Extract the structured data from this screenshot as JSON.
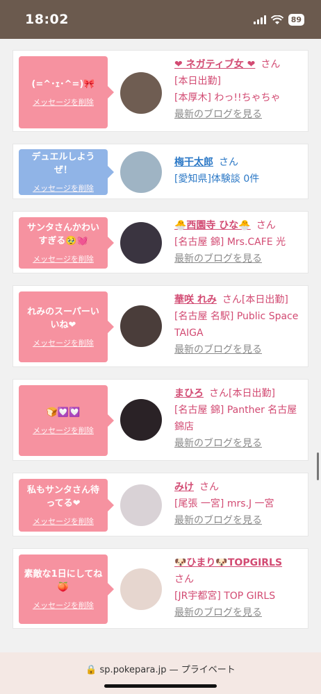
{
  "status": {
    "time": "18:02",
    "battery": "89"
  },
  "delete_label": "メッセージを削除",
  "san_label": "さん",
  "blog_label": "最新のブログを見る",
  "cards": [
    {
      "message": "(=^･ｪ･^=)🎀",
      "name": "❤︎ ネガティブ女 ❤︎",
      "tag": "",
      "lines": [
        "[本日出勤]",
        "[本厚木] わっ!!ちゃちゃ"
      ],
      "blog": true,
      "theme": "pink",
      "avatar_color": "#6f5d52"
    },
    {
      "message": "デュエルしようぜ！",
      "name": "梅干太郎",
      "tag": "",
      "lines": [
        "[愛知県]体験談 0件"
      ],
      "blog": false,
      "theme": "blue",
      "avatar_color": "#9fb4c4"
    },
    {
      "message": "サンタさんかわいすぎる🥹💓",
      "name": "🐣西園寺 ひな🐣",
      "tag": "",
      "lines": [
        "[名古屋 錦] Mrs.CAFE 光"
      ],
      "blog": true,
      "theme": "pink",
      "avatar_color": "#3a3440"
    },
    {
      "message": "れみのスーパーいいね❤︎",
      "name": "華咲 れみ",
      "tag": "[本日出勤]",
      "lines": [
        "[名古屋 名駅] Public Space TAIGA"
      ],
      "blog": true,
      "theme": "pink",
      "avatar_color": "#4a3d3a"
    },
    {
      "message": "🍞💟💟",
      "name": "まひろ",
      "tag": "[本日出勤]",
      "lines": [
        "[名古屋 錦] Panther 名古屋錦店"
      ],
      "blog": true,
      "theme": "pink",
      "avatar_color": "#2a2226"
    },
    {
      "message": "私もサンタさん待ってる❤︎",
      "name": "みけ",
      "tag": "",
      "lines": [
        "[尾張 一宮] mrs.J 一宮"
      ],
      "blog": true,
      "theme": "pink",
      "avatar_color": "#d9d2d6"
    },
    {
      "message": "素敵な1日にしてね🍑",
      "name": "🐶ひまり🐶TOPGIRLS",
      "tag": "",
      "lines": [
        "[JR宇都宮] TOP GIRLS"
      ],
      "blog": true,
      "theme": "pink",
      "avatar_color": "#e6d6cf"
    }
  ],
  "browser": {
    "url": "sp.pokepara.jp",
    "privacy": "プライベート"
  }
}
